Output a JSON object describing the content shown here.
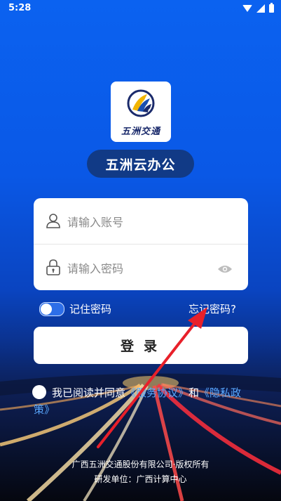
{
  "status_bar": {
    "time": "5:28"
  },
  "app": {
    "logo_text": "五洲交通",
    "title": "五洲云办公"
  },
  "form": {
    "account_placeholder": "请输入账号",
    "password_placeholder": "请输入密码",
    "remember_label": "记住密码",
    "remember_on": true,
    "forgot_label": "忘记密码?",
    "login_label": "登录"
  },
  "agreement": {
    "prefix": "我已阅读并同意",
    "service_link": "《服务协议》",
    "and": "和",
    "privacy_link": "《隐私政策》"
  },
  "footer": {
    "copyright": "广西五洲交通股份有限公司·版权所有",
    "developer": "研发单位：广西计算中心"
  },
  "colors": {
    "primary_bg": "#0b62f0",
    "title_pill": "#113a86",
    "link": "#5aa9ff",
    "arrow": "#e8202a"
  }
}
